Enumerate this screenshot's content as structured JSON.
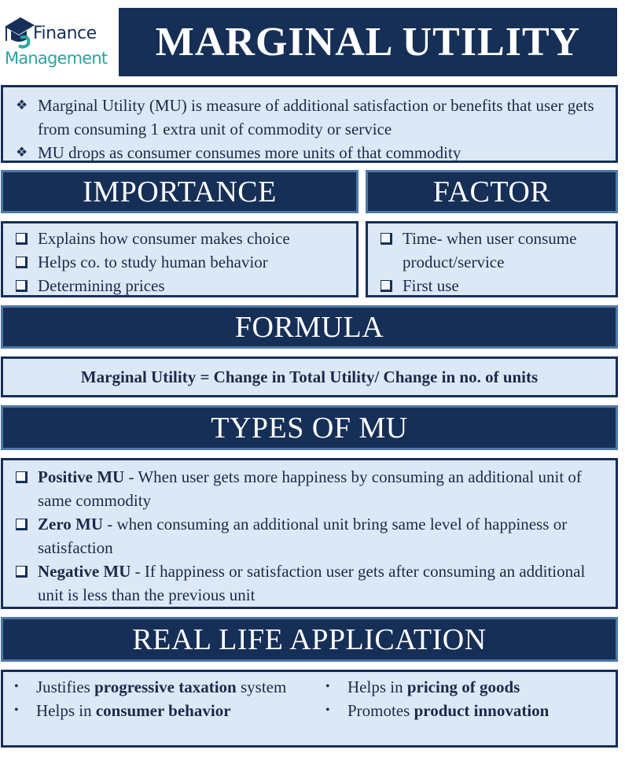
{
  "logo": {
    "icon": "graduation-cap-icon",
    "line1": "Finance",
    "line2": "Management",
    "colors": {
      "primary": "#163059",
      "secondary": "#2aa6a0"
    }
  },
  "title": "MARGINAL UTILITY",
  "intro": {
    "bullet_icon": "diamond-bullet-icon",
    "items": [
      "Marginal Utility (MU) is measure of additional satisfaction or benefits that user gets from consuming  1 extra unit of commodity or service",
      "MU drops as consumer consumes more units of that commodity"
    ]
  },
  "importance": {
    "heading": "IMPORTANCE",
    "items": [
      "Explains how consumer makes choice",
      "Helps co. to study human behavior",
      "Determining prices"
    ]
  },
  "factor": {
    "heading": "FACTOR",
    "items": [
      "Time- when user consume product/service",
      "First use"
    ]
  },
  "formula": {
    "heading": "FORMULA",
    "text": "Marginal Utility = Change in Total Utility/ Change in no. of units"
  },
  "types": {
    "heading": "TYPES OF MU",
    "items": [
      {
        "term": "Positive MU",
        "desc": " - When user gets more happiness by consuming an additional unit of same commodity"
      },
      {
        "term": "Zero MU",
        "desc": " - when consuming an additional unit bring same level of happiness or satisfaction"
      },
      {
        "term": "Negative MU",
        "desc": " - If happiness or satisfaction user gets after consuming an additional unit is less than the previous unit"
      }
    ]
  },
  "application": {
    "heading": "REAL LIFE APPLICATION",
    "left": [
      {
        "prefix": "Justifies ",
        "bold": "progressive taxation",
        "suffix": " system"
      },
      {
        "prefix": "Helps in ",
        "bold": "consumer behavior",
        "suffix": ""
      }
    ],
    "right": [
      {
        "prefix": "Helps in ",
        "bold": "pricing of  goods",
        "suffix": ""
      },
      {
        "prefix": "Promotes ",
        "bold": "product innovation",
        "suffix": ""
      }
    ]
  },
  "colors": {
    "navy": "#162f57",
    "light_box": "#dce8f5",
    "header_border": "#4c78a6"
  }
}
